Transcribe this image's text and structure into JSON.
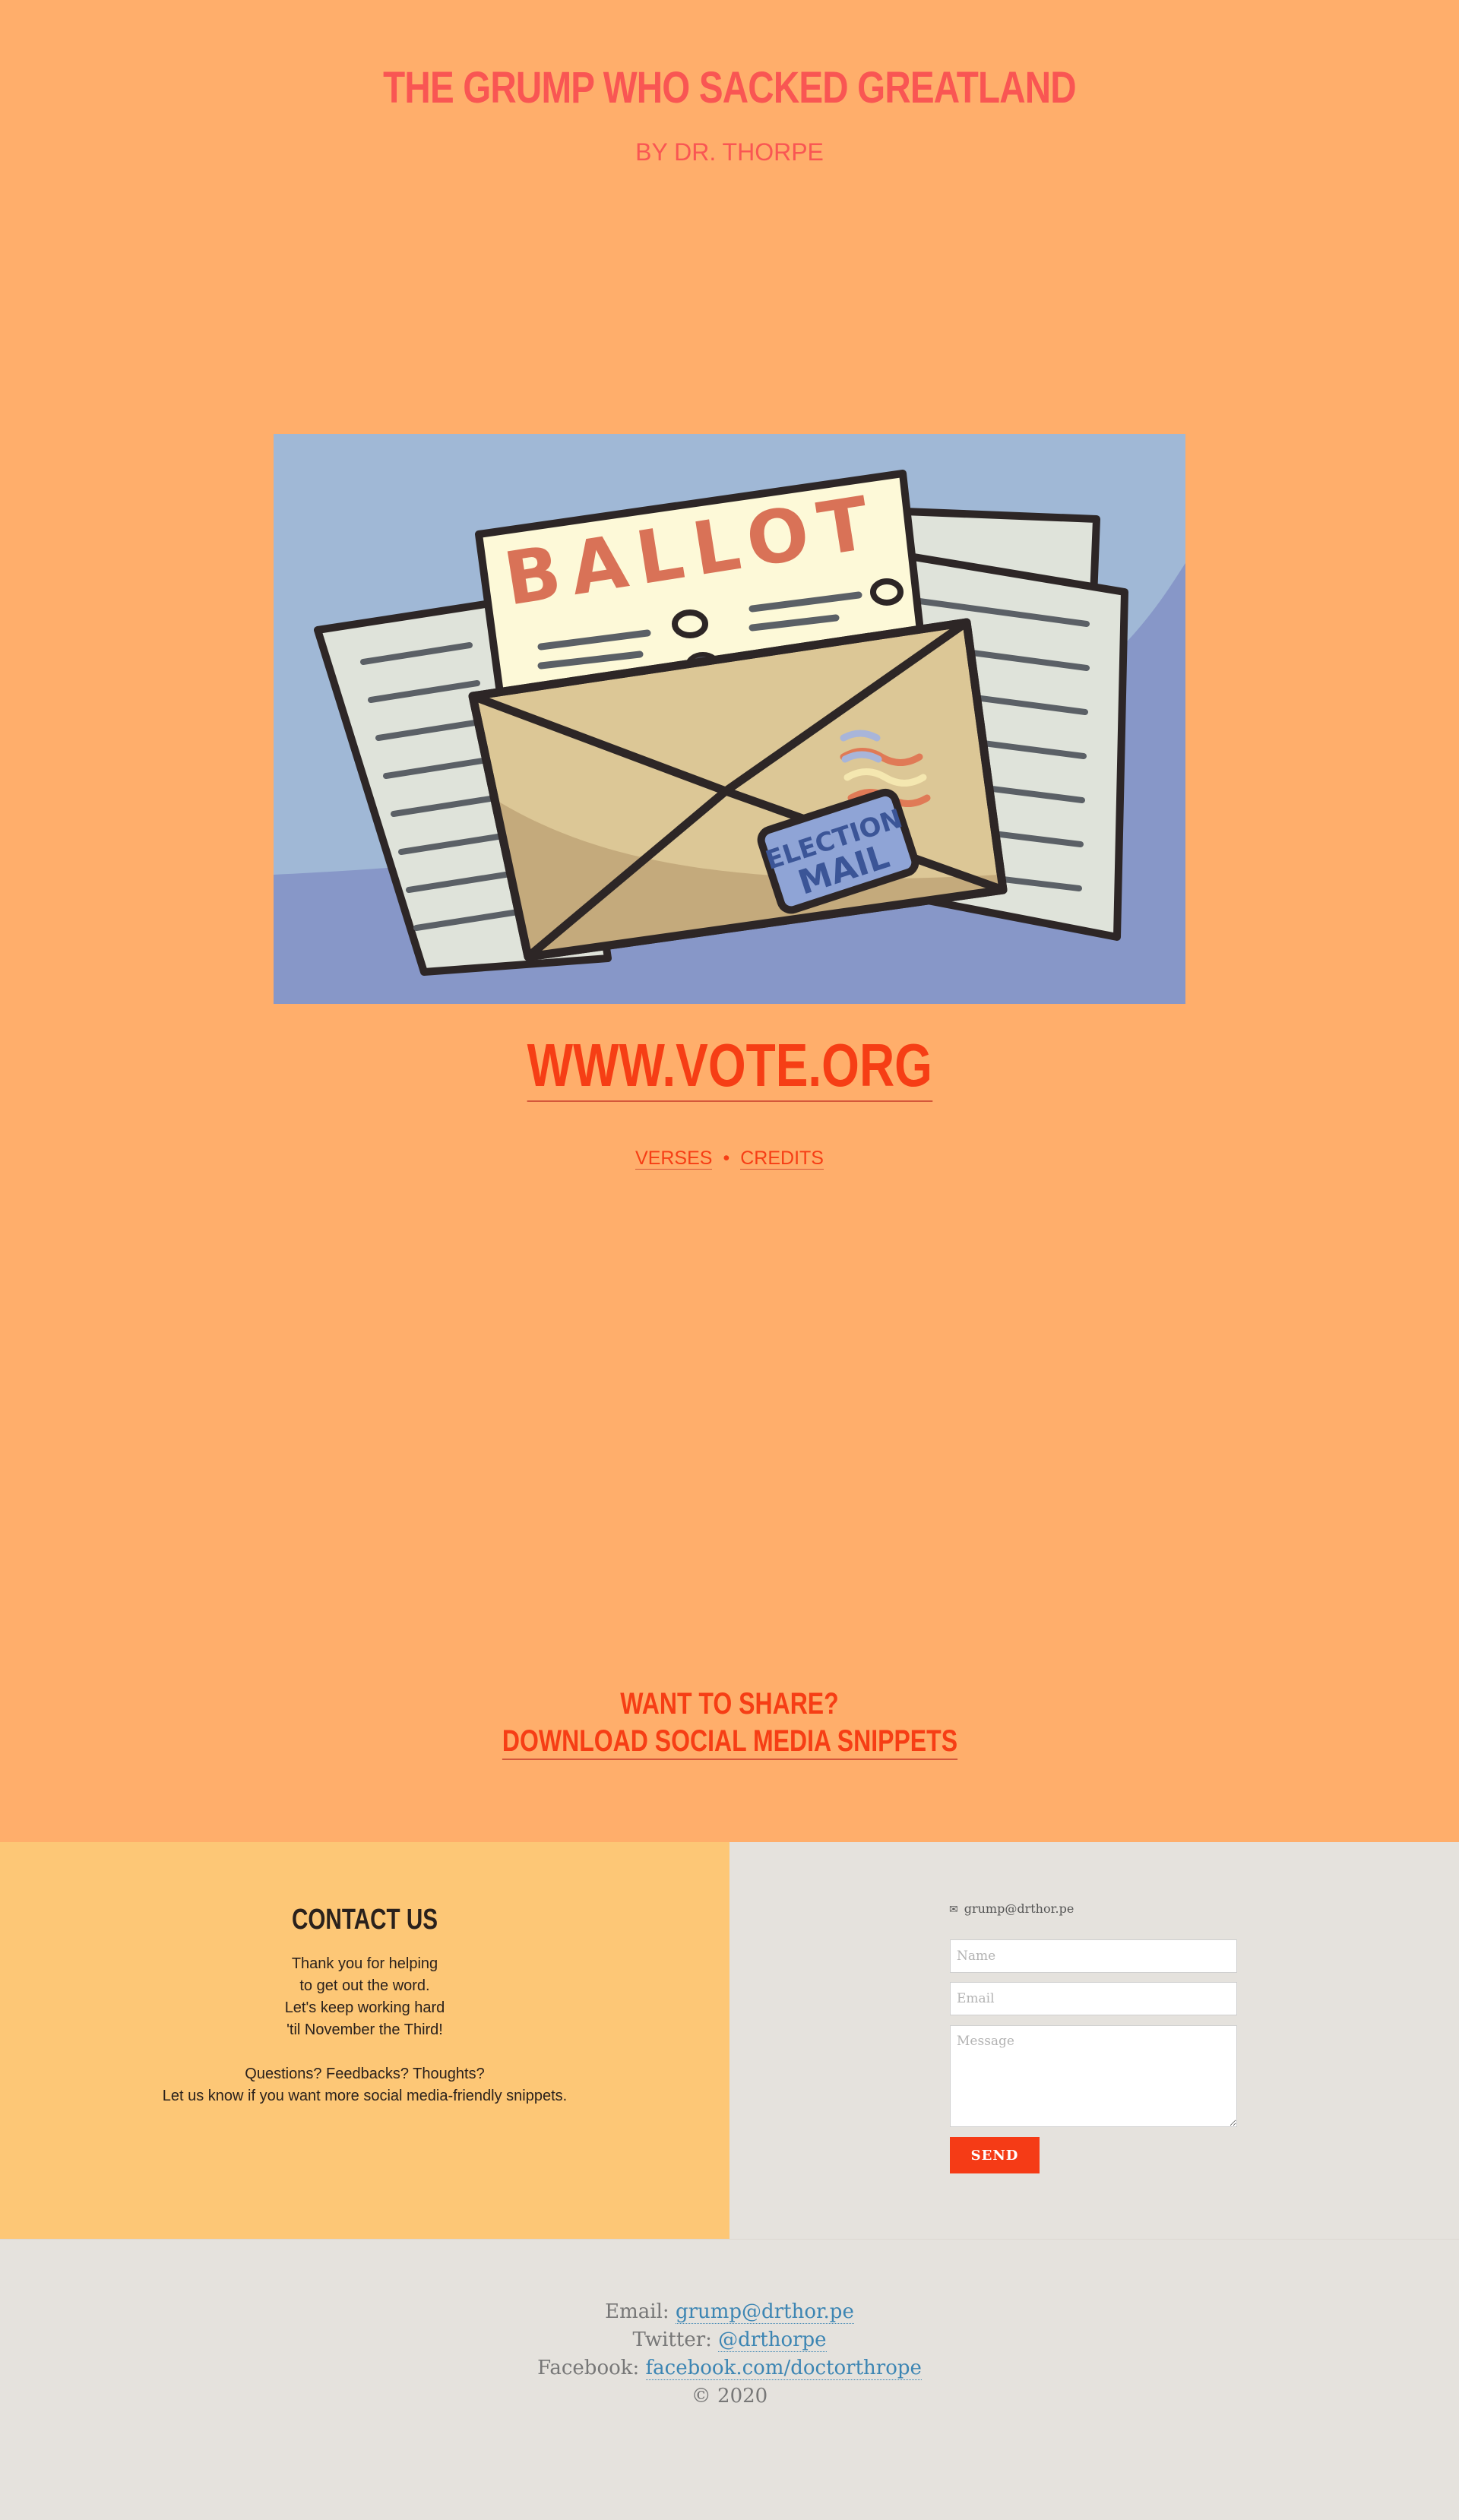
{
  "header": {
    "title": "THE GRUMP WHO SACKED GREATLAND",
    "byline": "BY DR. THORPE"
  },
  "illustration": {
    "ballot_text": "BALLOT",
    "stamp_line1": "ELECTION",
    "stamp_line2": "MAIL"
  },
  "main": {
    "vote_link": "WWW.VOTE.ORG",
    "nav": {
      "verses": "VERSES",
      "separator": "•",
      "credits": "CREDITS"
    },
    "share_question": "WANT TO SHARE?",
    "share_link": "DOWNLOAD SOCIAL MEDIA SNIPPETS"
  },
  "contact": {
    "title": "CONTACT US",
    "lines": [
      "Thank you for helping",
      "to get out the word.",
      "Let's keep working hard",
      "'til November the Third!"
    ],
    "lines2": [
      "Questions? Feedbacks? Thoughts?",
      "Let us know if you want more social media-friendly snippets."
    ],
    "email_label": "grump@drthor.pe",
    "form": {
      "name_placeholder": "Name",
      "email_placeholder": "Email",
      "message_placeholder": "Message",
      "send_label": "SEND"
    }
  },
  "footer": {
    "email_label": "Email:",
    "email_value": "grump@drthor.pe",
    "twitter_label": "Twitter:",
    "twitter_value": "@drthorpe",
    "facebook_label": "Facebook:",
    "facebook_value": "facebook.com/doctorthrope",
    "copyright": "© 2020"
  },
  "colors": {
    "hero_bg": "#ffae6b",
    "title": "#f95653",
    "link": "#f63e15",
    "contact_left_bg": "#fdc776",
    "contact_right_bg": "#e5e2dd",
    "send_button": "#f53b16"
  }
}
